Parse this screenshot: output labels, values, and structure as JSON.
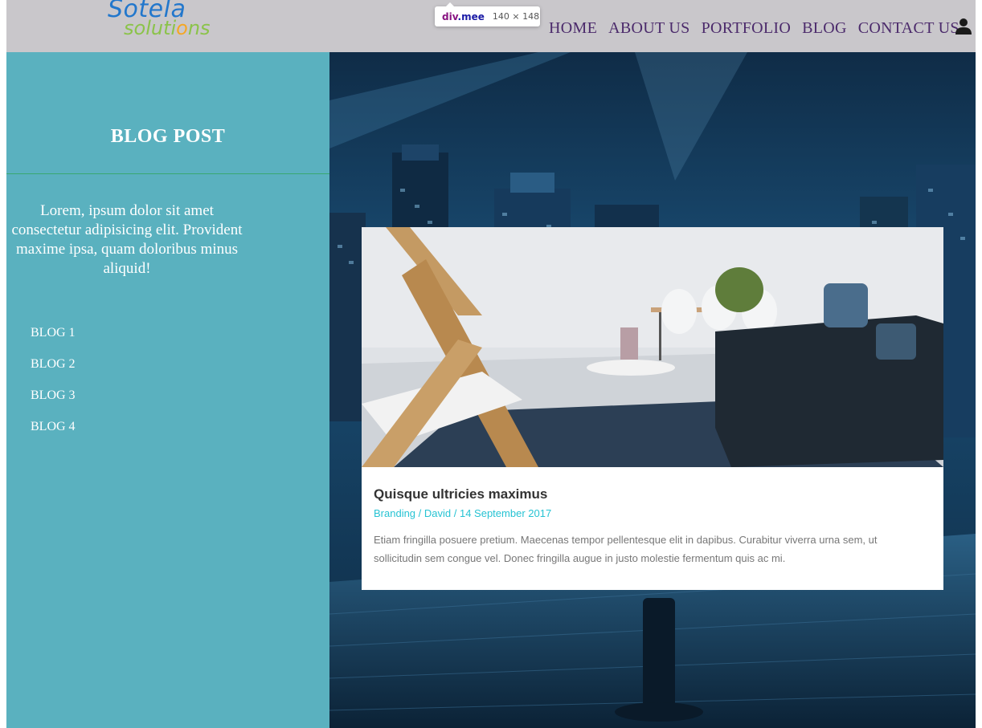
{
  "brand": {
    "logo_top": "Sotela",
    "logo_bottom_pre": "soluti",
    "logo_bottom_gear": "o",
    "logo_bottom_post": "ns"
  },
  "devtools_tooltip": {
    "tag": "div",
    "class": ".mee",
    "size": "140 × 148"
  },
  "nav": {
    "items": [
      {
        "label": "HOME"
      },
      {
        "label": "ABOUT US"
      },
      {
        "label": "PORTFOLIO"
      },
      {
        "label": "BLOG"
      },
      {
        "label": "CONTACT US"
      }
    ],
    "user_icon": "user-icon"
  },
  "sidebar": {
    "title": "BLOG POST",
    "text": "Lorem, ipsum dolor sit amet consectetur adipisicing elit. Provident maxime ipsa, quam doloribus minus aliquid!",
    "items": [
      {
        "label": "BLOG 1"
      },
      {
        "label": "BLOG 2"
      },
      {
        "label": "BLOG 3"
      },
      {
        "label": "BLOG 4"
      }
    ]
  },
  "post": {
    "title": "Quisque ultricies maximus",
    "category": "Branding",
    "sep1": " / ",
    "author": "David",
    "sep2": " / ",
    "date": "14 September 2017",
    "excerpt": "Etiam fringilla posuere pretium. Maecenas tempor pellentesque elit in dapibus. Curabitur viverra urna sem, ut sollicitudin sem congue vel. Donec fringilla augue in justo molestie fermentum quis ac mi."
  },
  "colors": {
    "header_bg": "#c9c7cb",
    "nav_text": "#4b2a6b",
    "sidebar_bg": "#5ab1bf",
    "divider": "#3aa870",
    "meta_accent": "#27c3d3"
  }
}
